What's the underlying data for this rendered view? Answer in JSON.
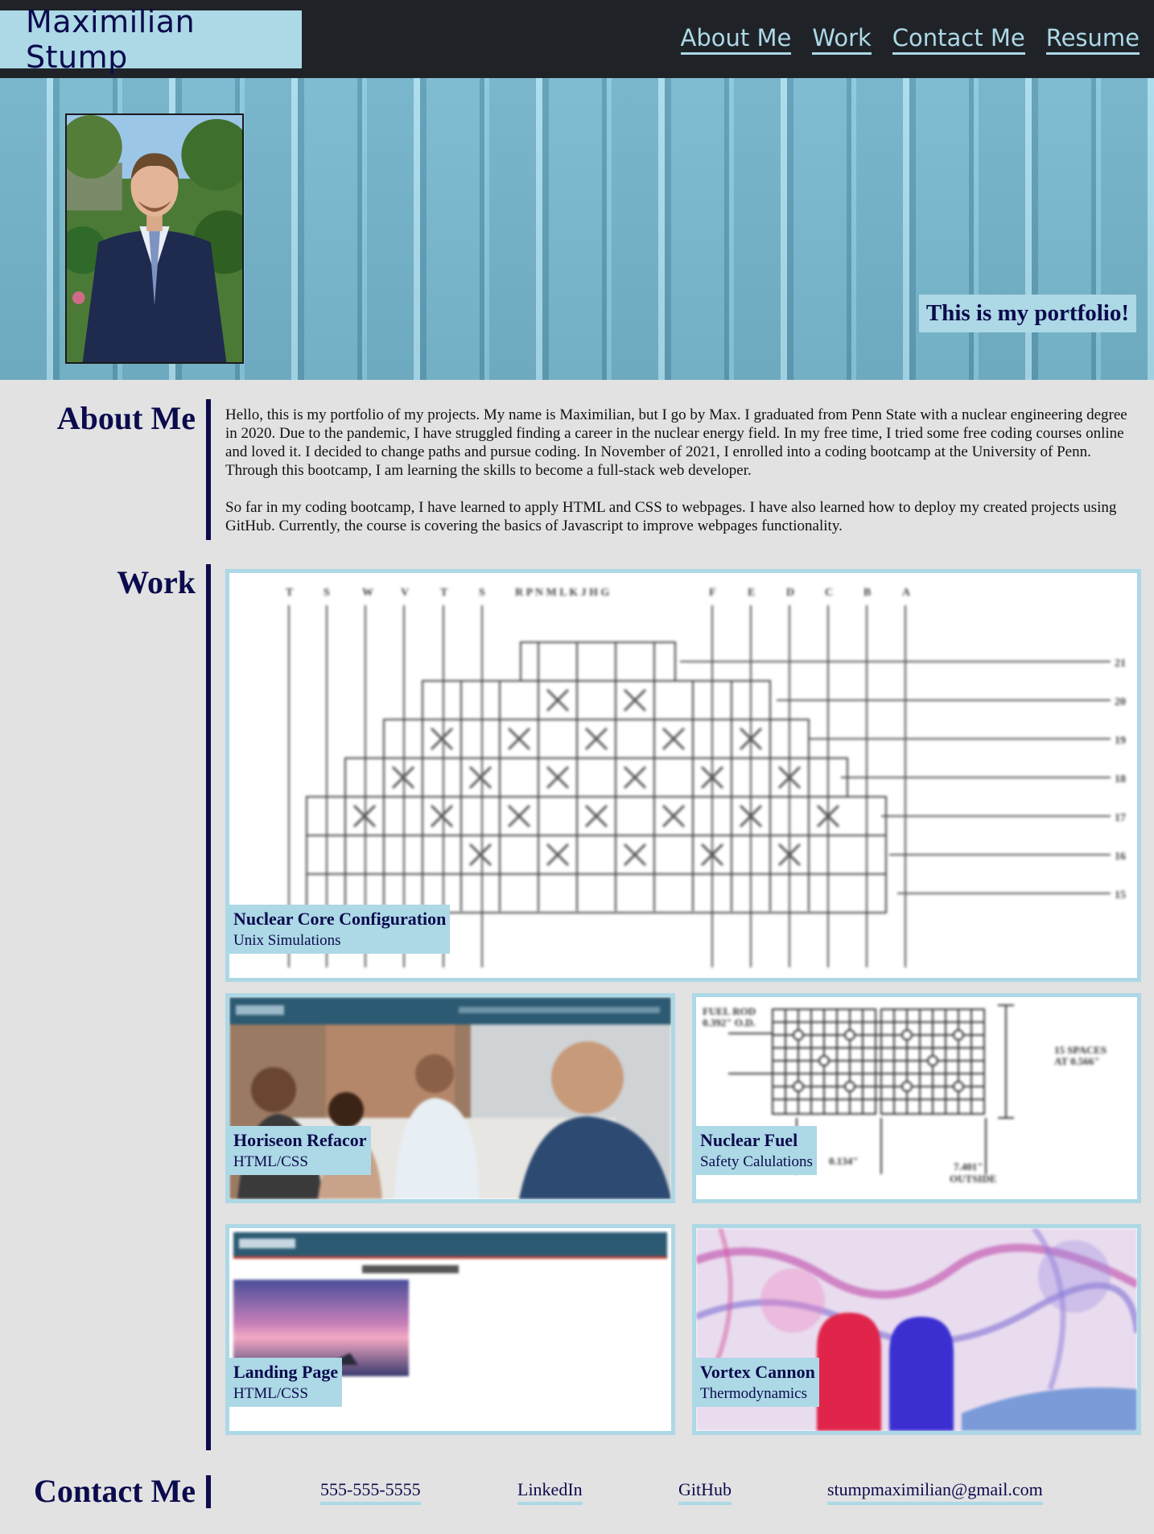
{
  "header": {
    "brand": "Maximilian Stump",
    "nav": [
      "About Me",
      "Work",
      "Contact Me",
      "Resume"
    ]
  },
  "hero": {
    "tagline": "This is my portfolio!"
  },
  "about": {
    "title": "About Me",
    "paragraphs": [
      "Hello, this is my portfolio of my projects. My name is Maximilian, but I go by Max. I graduated from Penn State with a nuclear engineering degree in 2020. Due to the pandemic, I have struggled finding a career in the nuclear energy field. In my free time, I tried some free coding courses online and loved it. I decided to change paths and pursue coding. In November of 2021, I enrolled into a coding bootcamp at the University of Penn. Through this bootcamp, I am learning the skills to become a full-stack web developer.",
      "So far in my coding bootcamp, I have learned to apply HTML and CSS to webpages. I have also learned how to deploy my created projects using GitHub. Currently, the course is covering the basics of Javascript to improve webpages functionality."
    ]
  },
  "work": {
    "title": "Work",
    "projects": [
      {
        "title": "Nuclear Core Configuration",
        "subtitle": "Unix Simulations",
        "image": "core-grid-diagram"
      },
      {
        "title": "Horiseon Refacor",
        "subtitle": "HTML/CSS",
        "image": "office-team-photo"
      },
      {
        "title": "Nuclear Fuel",
        "subtitle": "Safety Calulations",
        "image": "fuel-rod-diagram"
      },
      {
        "title": "Landing Page",
        "subtitle": "HTML/CSS",
        "image": "landing-page-screenshot"
      },
      {
        "title": "Vortex Cannon",
        "subtitle": "Thermodynamics",
        "image": "vortex-smoke-photo"
      }
    ]
  },
  "contact": {
    "title": "Contact Me",
    "links": [
      "555-555-5555",
      "LinkedIn",
      "GitHub",
      "stumpmaximilian@gmail.com"
    ]
  },
  "colors": {
    "header_bg": "#1f2328",
    "accent": "#add8e6",
    "navy": "#0b0b4d",
    "page_bg": "#e2e2e2"
  }
}
